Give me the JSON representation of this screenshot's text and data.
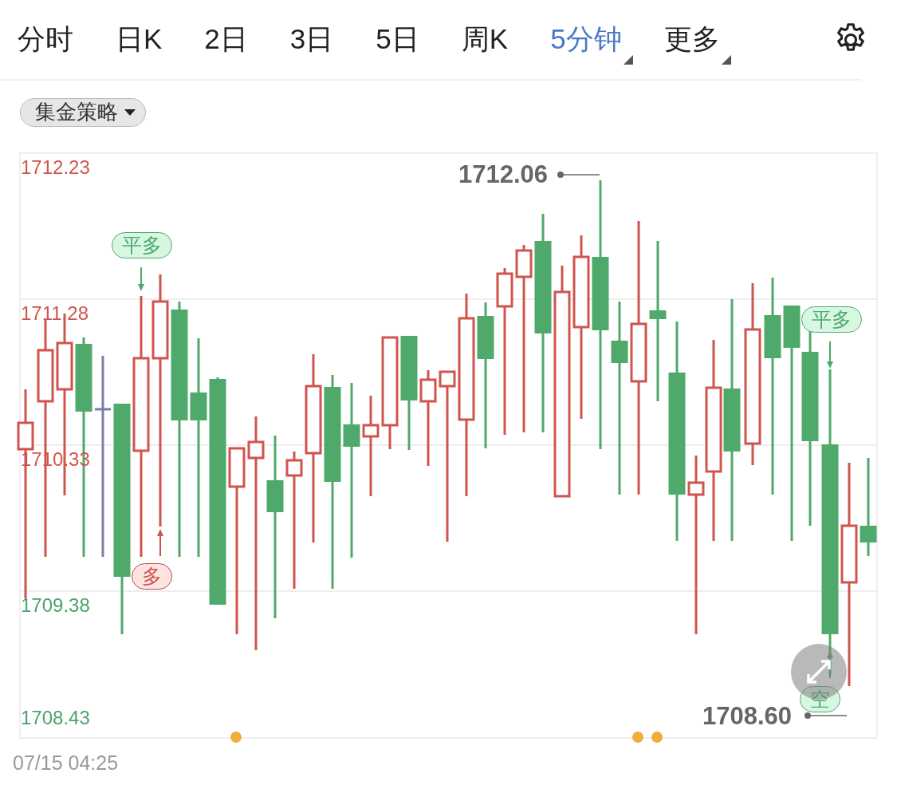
{
  "tabs": [
    {
      "label": "分时",
      "selected": false,
      "dropdown": false
    },
    {
      "label": "日K",
      "selected": false,
      "dropdown": false
    },
    {
      "label": "2日",
      "selected": false,
      "dropdown": false
    },
    {
      "label": "3日",
      "selected": false,
      "dropdown": false
    },
    {
      "label": "5日",
      "selected": false,
      "dropdown": false
    },
    {
      "label": "周K",
      "selected": false,
      "dropdown": false
    },
    {
      "label": "5分钟",
      "selected": true,
      "dropdown": true
    },
    {
      "label": "更多",
      "selected": false,
      "dropdown": true
    }
  ],
  "strategy_selector": {
    "label": "集金策略"
  },
  "chart": {
    "y_labels": [
      {
        "text": "1712.23",
        "color": "#d0544d"
      },
      {
        "text": "1711.28",
        "color": "#d0544d"
      },
      {
        "text": "1710.33",
        "color": "#d0544d"
      },
      {
        "text": "1709.38",
        "color": "#4aa36a"
      },
      {
        "text": "1708.43",
        "color": "#4aa36a"
      }
    ],
    "high_label": "1712.06",
    "low_label": "1708.60",
    "signals": [
      {
        "label": "平多",
        "kind": "close_long"
      },
      {
        "label": "多",
        "kind": "long"
      },
      {
        "label": "平多",
        "kind": "close_long"
      },
      {
        "label": "空",
        "kind": "short"
      }
    ]
  },
  "timestamp": "07/15 04:25"
}
